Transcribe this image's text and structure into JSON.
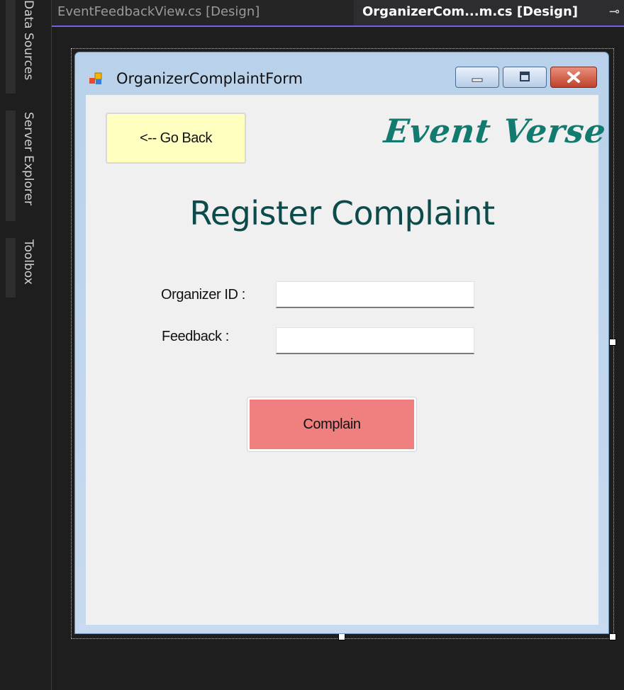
{
  "ide": {
    "dock_panels": [
      "Data Sources",
      "Server Explorer",
      "Toolbox"
    ],
    "tabs": {
      "inactive": "EventFeedbackView.cs [Design]",
      "active": "OrganizerCom...m.cs [Design]",
      "pin_glyph": "⊸"
    }
  },
  "form": {
    "title": "OrganizerComplaintForm",
    "go_back_label": "<-- Go Back",
    "logo_text": "Event Verse",
    "heading": "Register Complaint",
    "organizer_id_label": "Organizer ID :",
    "organizer_id_value": "",
    "feedback_label": "Feedback :",
    "feedback_value": "",
    "complain_label": "Complain"
  },
  "colors": {
    "go_back_bg": "#ffffc0",
    "complain_bg": "#f08080",
    "logo": "#127a6e",
    "heading": "#0d4a4a",
    "active_tab_underline": "#7160e8"
  },
  "icons": [
    "app-form-icon",
    "minimize-icon",
    "maximize-icon",
    "close-icon",
    "pin-icon"
  ]
}
